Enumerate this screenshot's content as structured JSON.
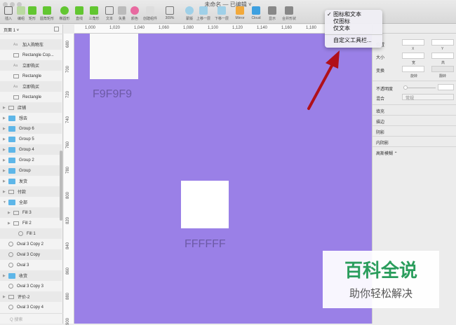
{
  "window": {
    "title": "未命名 — 已编辑 ˅"
  },
  "toolbar": [
    {
      "label": "插入",
      "icon": "plus-icon",
      "color": "#666"
    },
    {
      "label": "编组",
      "icon": "group-icon",
      "color": "#b9d9a0"
    },
    {
      "label": "矩形",
      "icon": "rectangle-icon",
      "color": "#62c631"
    },
    {
      "label": "圆角矩形",
      "icon": "rounded-rectangle-icon",
      "color": "#62c631"
    },
    {
      "label": "椭圆形",
      "icon": "oval-icon",
      "color": "#62c631"
    },
    {
      "label": "直线",
      "icon": "line-icon",
      "color": "#62c631"
    },
    {
      "label": "三角形",
      "icon": "triangle-icon",
      "color": "#62c631"
    },
    {
      "label": "文本",
      "icon": "text-icon",
      "color": "#777"
    },
    {
      "label": "矢量",
      "icon": "vector-icon",
      "color": "#bbb"
    },
    {
      "label": "颜色",
      "icon": "color-wheel-icon",
      "color": "#e86aa0"
    },
    {
      "label": "创建组件",
      "icon": "symbol-icon",
      "color": "#ddd"
    },
    {
      "label": "309%",
      "icon": "zoom-icon",
      "color": "#777"
    },
    {
      "label": "蒙版",
      "icon": "mask-icon",
      "color": "#9fd0e8"
    },
    {
      "label": "上移一层",
      "icon": "forward-icon",
      "color": "#9fd0e8"
    },
    {
      "label": "下移一层",
      "icon": "backward-icon",
      "color": "#9fd0e8"
    },
    {
      "label": "Mirror",
      "icon": "mirror-icon",
      "color": "#f2a93b"
    },
    {
      "label": "Cloud",
      "icon": "cloud-icon",
      "color": "#3ea0e0"
    },
    {
      "label": "显示",
      "icon": "view-icon",
      "color": "#888"
    },
    {
      "label": "合并形状",
      "icon": "combine-icon",
      "color": "#888"
    }
  ],
  "sidebar": {
    "page_selector": "页面 1 ˅",
    "layers": [
      {
        "label": "加入购物车",
        "type": "text",
        "indent": 1
      },
      {
        "label": "Rectangle Cop...",
        "type": "rect",
        "indent": 1
      },
      {
        "label": "立即购买",
        "type": "text",
        "indent": 1
      },
      {
        "label": "Rectangle",
        "type": "rect",
        "indent": 1
      },
      {
        "label": "立即购买",
        "type": "text",
        "indent": 1
      },
      {
        "label": "Rectangle",
        "type": "rect",
        "indent": 1
      },
      {
        "label": "店铺",
        "type": "symbol",
        "indent": 0,
        "arrow": "▶"
      },
      {
        "label": "想去",
        "type": "folder",
        "indent": 0,
        "arrow": "▶"
      },
      {
        "label": "Group 6",
        "type": "folder",
        "indent": 0,
        "arrow": "▶"
      },
      {
        "label": "Group 5",
        "type": "folder",
        "indent": 0,
        "arrow": "▶"
      },
      {
        "label": "Group 4",
        "type": "folder",
        "indent": 0,
        "arrow": "▶"
      },
      {
        "label": "Group 2",
        "type": "folder",
        "indent": 0,
        "arrow": "▶"
      },
      {
        "label": "Group",
        "type": "folder",
        "indent": 0,
        "arrow": "▶"
      },
      {
        "label": "发货",
        "type": "folder",
        "indent": 0,
        "arrow": "▶"
      },
      {
        "label": "付款",
        "type": "symbol",
        "indent": 0,
        "arrow": "▶"
      },
      {
        "label": "全部",
        "type": "folder",
        "indent": 0,
        "arrow": "▼"
      },
      {
        "label": "Fill 3",
        "type": "symbol",
        "indent": 1,
        "arrow": "▶"
      },
      {
        "label": "Fill 2",
        "type": "rect",
        "indent": 1,
        "arrow": "▶"
      },
      {
        "label": "Fill 1",
        "type": "oval",
        "indent": 2
      },
      {
        "label": "Oval 3 Copy 2",
        "type": "oval",
        "indent": 0
      },
      {
        "label": "Oval 3 Copy",
        "type": "oval",
        "indent": 0
      },
      {
        "label": "Oval 3",
        "type": "oval",
        "indent": 0
      },
      {
        "label": "收货",
        "type": "folder",
        "indent": 0,
        "arrow": "▶"
      },
      {
        "label": "Oval 3 Copy 3",
        "type": "oval",
        "indent": 0
      },
      {
        "label": "评价-2",
        "type": "symbol",
        "indent": 0,
        "arrow": "▶"
      },
      {
        "label": "Oval 3 Copy 4",
        "type": "oval",
        "indent": 0
      }
    ],
    "search_placeholder": "Q 搜索"
  },
  "rulers": {
    "horizontal": [
      "1,000",
      "1,020",
      "1,040",
      "1,060",
      "1,080",
      "1,100",
      "1,120",
      "1,140",
      "1,160",
      "1,180"
    ],
    "vertical": [
      "680",
      "700",
      "720",
      "740",
      "760",
      "780",
      "800",
      "820",
      "840",
      "860",
      "880",
      "900"
    ]
  },
  "canvas": {
    "background": "#9a80e7",
    "swatches": [
      {
        "color": "#F9F9F9",
        "label": "F9F9F9"
      },
      {
        "color": "#FFFFFF",
        "label": "FFFFFF"
      }
    ]
  },
  "inspector": {
    "position": "位置",
    "x": "X",
    "y": "Y",
    "size": "大小",
    "width": "宽",
    "height": "高",
    "transform": "变换",
    "rotate": "旋转",
    "flip": "翻转",
    "opacity": "不透明度",
    "blend": "混合",
    "blend_value": "常规",
    "sections": [
      "填充",
      "描边",
      "阴影",
      "内阴影",
      "高斯模糊 ⌃"
    ]
  },
  "context_menu": {
    "items": [
      {
        "label": "图标和文本",
        "checked": true
      },
      {
        "label": "仅图标",
        "checked": false
      },
      {
        "label": "仅文本",
        "checked": false
      }
    ],
    "customize": "自定义工具栏..."
  },
  "watermark": {
    "line1": "百科全说",
    "line2": "助你轻松解决"
  }
}
